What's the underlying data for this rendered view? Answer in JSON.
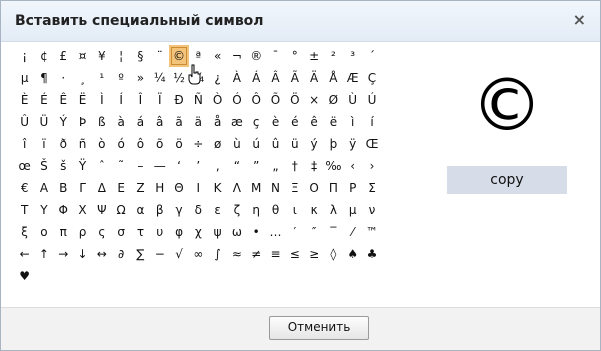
{
  "dialog": {
    "title": "Вставить специальный символ",
    "close_glyph": "×"
  },
  "symbols": [
    [
      "¡",
      "¢",
      "£",
      "¤",
      "¥",
      "¦",
      "§",
      "¨",
      "©",
      "ª",
      "«",
      "¬",
      "®",
      "¯",
      "°",
      "±",
      "²",
      "³",
      "´"
    ],
    [
      "µ",
      "¶",
      "·",
      "¸",
      "¹",
      "º",
      "»",
      "¼",
      "½",
      "¾",
      "¿",
      "À",
      "Á",
      "Â",
      "Ã",
      "Ä",
      "Å",
      "Æ",
      "Ç"
    ],
    [
      "È",
      "É",
      "Ê",
      "Ë",
      "Ì",
      "Í",
      "Î",
      "Ï",
      "Ð",
      "Ñ",
      "Ò",
      "Ó",
      "Ô",
      "Õ",
      "Ö",
      "×",
      "Ø",
      "Ù",
      "Ú"
    ],
    [
      "Û",
      "Ü",
      "Ý",
      "Þ",
      "ß",
      "à",
      "á",
      "â",
      "ã",
      "ä",
      "å",
      "æ",
      "ç",
      "è",
      "é",
      "ê",
      "ë",
      "ì",
      "í"
    ],
    [
      "î",
      "ï",
      "ð",
      "ñ",
      "ò",
      "ó",
      "ô",
      "õ",
      "ö",
      "÷",
      "ø",
      "ù",
      "ú",
      "û",
      "ü",
      "ý",
      "þ",
      "ÿ",
      "Œ"
    ],
    [
      "œ",
      "Š",
      "š",
      "Ÿ",
      "ˆ",
      "˜",
      "–",
      "—",
      "‘",
      "’",
      "‚",
      "“",
      "”",
      "„",
      "†",
      "‡",
      "‰",
      "‹",
      "›"
    ],
    [
      "€",
      "Α",
      "Β",
      "Γ",
      "Δ",
      "Ε",
      "Ζ",
      "Η",
      "Θ",
      "Ι",
      "Κ",
      "Λ",
      "Μ",
      "Ν",
      "Ξ",
      "Ο",
      "Π",
      "Ρ",
      "Σ"
    ],
    [
      "Τ",
      "Υ",
      "Φ",
      "Χ",
      "Ψ",
      "Ω",
      "α",
      "β",
      "γ",
      "δ",
      "ε",
      "ζ",
      "η",
      "θ",
      "ι",
      "κ",
      "λ",
      "μ",
      "ν"
    ],
    [
      "ξ",
      "ο",
      "π",
      "ρ",
      "ς",
      "σ",
      "τ",
      "υ",
      "φ",
      "χ",
      "ψ",
      "ω",
      "•",
      "…",
      "′",
      "″",
      "‾",
      "⁄",
      "™"
    ],
    [
      "←",
      "↑",
      "→",
      "↓",
      "↔",
      "∂",
      "∑",
      "−",
      "√",
      "∞",
      "∫",
      "≈",
      "≠",
      "≡",
      "≤",
      "≥",
      "◊",
      "♠",
      "♣"
    ],
    [
      "♥"
    ]
  ],
  "selected": {
    "row": 0,
    "col": 8
  },
  "preview": {
    "glyph": "©",
    "name": "copy"
  },
  "footer": {
    "cancel_label": "Отменить"
  }
}
